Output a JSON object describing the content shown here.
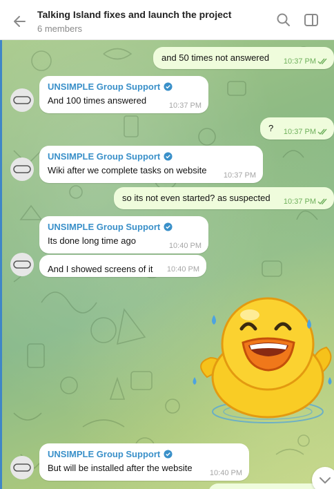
{
  "header": {
    "title": "Talking Island fixes and launch the project",
    "subtitle": "6 members"
  },
  "messages": [
    {
      "dir": "out",
      "text": "and 50 times not answered",
      "time": "10:37 PM"
    },
    {
      "dir": "in",
      "sender": "UNSIMPLE Group Support",
      "text": "And 100 times answered",
      "time": "10:37 PM"
    },
    {
      "dir": "out",
      "text": "?",
      "time": "10:37 PM"
    },
    {
      "dir": "in",
      "sender": "UNSIMPLE Group Support",
      "text": "Wiki after we complete tasks on website",
      "time": "10:37 PM"
    },
    {
      "dir": "out",
      "text": "so its not even started? as suspected",
      "time": "10:37 PM"
    },
    {
      "dir": "in",
      "sender": "UNSIMPLE Group Support",
      "text": "Its done long time ago",
      "time": "10:40 PM"
    },
    {
      "dir": "in",
      "text": "And I showed screens of it",
      "time": "10:40 PM"
    },
    {
      "dir": "in",
      "sender": "UNSIMPLE Group Support",
      "text": "But will be installed after the website",
      "time": "10:40 PM"
    }
  ],
  "sticker": {
    "icon": "laughing-duck-sticker"
  },
  "colors": {
    "accent": "#3a90c9",
    "outgoing": "#effcdc",
    "incoming": "#ffffff",
    "check": "#6fb05c"
  }
}
